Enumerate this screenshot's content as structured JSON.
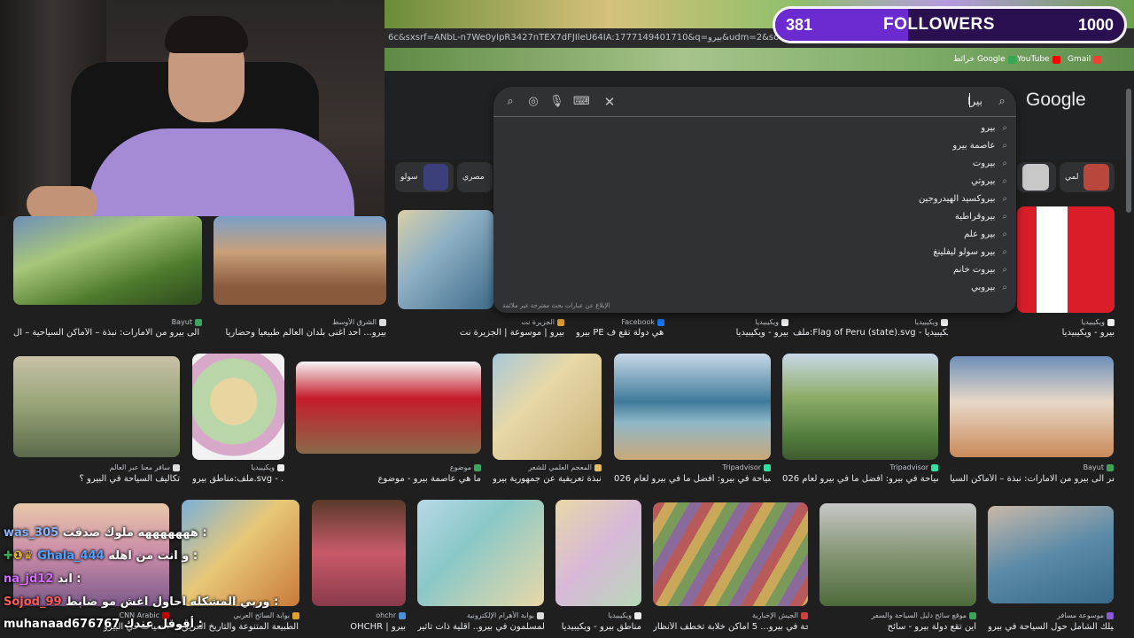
{
  "stream": {
    "followers_count": "381",
    "followers_label": "FOLLOWERS",
    "followers_goal": "1000",
    "followers_progress": 0.381
  },
  "browser": {
    "url_text": "6c&sxsrf=ANbL-n7We0yIpR3427nTEX7dFJIleU64IA:1777149401710&q=بيرو&udm=2&source=iu&ictx=1&",
    "bookmarks": [
      {
        "label": "Gmail",
        "icon": "gmail-icon",
        "color": "#ea4335"
      },
      {
        "label": "YouTube",
        "icon": "youtube-icon",
        "color": "#ff0000"
      },
      {
        "label": "خرائط Google",
        "icon": "maps-icon",
        "color": "#34a853"
      }
    ]
  },
  "google": {
    "logo": "Google",
    "query": "بيرا",
    "suggestions": [
      "بيرو",
      "عاصمة بيرو",
      "بيروت",
      "بيروتي",
      "بيروكسيد الهيدروجين",
      "بيروقراطية",
      "بيرو علم",
      "بيرو سولو ليفلينغ",
      "بيروت خانم",
      "بيروبي"
    ],
    "report_text": "الإبلاغ عن عبارات بحث مقترحة غير ملائمة"
  },
  "chips": [
    {
      "label": "سولو",
      "color": "#3b3f7a"
    },
    {
      "label": "مصري",
      "color": "#303134"
    },
    {
      "label": "",
      "color": "#c8c8c8"
    },
    {
      "label": "لمي",
      "color": "#b9473e"
    }
  ],
  "results_row1": [
    {
      "source": "Bayut",
      "caption": "السفر الى بيرو من الامارات: نبذة – الأماكن السياحية – ال...",
      "colors": [
        "#4d7a2e",
        "#a8c77a",
        "#6e8fb8"
      ]
    },
    {
      "source": "الشرق الأوسط",
      "caption": "بيرو... أحد أغنى بلدان العالم طبيعياً وحضارياً",
      "colors": [
        "#8a5a3c",
        "#c9a07a",
        "#7aa0c8"
      ]
    },
    {
      "source": "الجزيرة نت",
      "caption": "بيرو | موسوعة | الجزيرة نت",
      "colors": [
        "#3e6c8a",
        "#8fb0c4",
        "#d9cfa8"
      ]
    },
    {
      "source": "Facebook",
      "caption": "بيرو PE هي دولة تقع ف...",
      "colors": [
        "#444",
        "#666",
        "#888"
      ]
    },
    {
      "source": "ويكيبيديا",
      "caption": "بيرو - ويكيبيديا",
      "colors": [
        "#d91e2a",
        "#ffffff",
        "#d91e2a"
      ]
    },
    {
      "source": "ويكيبيديا",
      "caption": "ملف:Flag of Peru (state).svg - ويكيبيديا ...",
      "colors": [
        "#d91e2a",
        "#ffffff",
        "#d91e2a"
      ]
    },
    {
      "source": "ويكيبيديا",
      "caption": "بيرو - ويكيبيديا",
      "colors": [
        "#d91e2a",
        "#ffffff",
        "#d91e2a"
      ]
    }
  ],
  "results_row2": [
    {
      "source": "سافر معنا عبر العالم",
      "caption": "تكاليف السياحة في البيرو ؟",
      "colors": [
        "#5c6b4a",
        "#9aa67a",
        "#c9c1a8"
      ]
    },
    {
      "source": "ويكيبيديا",
      "caption": "ملف:مناطق بيرو.svg - ...",
      "colors": [
        "#e8d5a0",
        "#b9d6a8",
        "#d8a8c8"
      ]
    },
    {
      "source": "موضوع",
      "caption": "ما هي عاصمة بيرو - موضوع",
      "colors": [
        "#c61b2a",
        "#f5f5f5",
        "#8a6a4a"
      ]
    },
    {
      "source": "المعجم العلمي للشعر",
      "caption": "نبذة تعريفية عن جمهورية بيرو -",
      "colors": [
        "#c9b178",
        "#e8d8a8",
        "#a8c8d8"
      ]
    },
    {
      "source": "Tripadvisor",
      "caption": "السياحة في بيرو: أفضل ما في بيرو لعام 026",
      "colors": [
        "#3f7a9a",
        "#8fb8c8",
        "#c9a878"
      ]
    },
    {
      "source": "Tripadvisor",
      "caption": "السياحة في بيرو: أفضل ما في بيرو لعام 026",
      "colors": [
        "#4e7a3a",
        "#8fae6a",
        "#3f5a2e"
      ]
    },
    {
      "source": "Bayut",
      "caption": "السفر الى بيرو من الامارات: نبذة – الأماكن السيا...",
      "colors": [
        "#6e8fb8",
        "#c98a5a",
        "#e8d8c8"
      ]
    }
  ],
  "results_row3": [
    {
      "source": "CNN Arabic",
      "caption": "السياحة في البيرو",
      "colors": [
        "#7a5a8a",
        "#c98aa8",
        "#e8c8a8"
      ]
    },
    {
      "source": "بوابة السائح العربي",
      "caption": "الطبيعة المتنوعة والتاريخ العريق ...",
      "colors": [
        "#7ab0d8",
        "#e8c878",
        "#c97a3a"
      ]
    },
    {
      "source": "ohchr",
      "caption": "OHCHR | بيرو",
      "colors": [
        "#8a3a4a",
        "#c95a6a",
        "#5a3a2a"
      ]
    },
    {
      "source": "بوابة الأهرام الإلكترونية",
      "caption": "المسلمون في بيرو.. أقلية ذات تأثير...",
      "colors": [
        "#8ac8c8",
        "#e8d8a8",
        "#b8d8e8"
      ]
    },
    {
      "source": "ويكيبيديا",
      "caption": "مناطق بيرو - ويكيبيديا",
      "colors": [
        "#e8d8a8",
        "#d8b8d8",
        "#b8d8b8"
      ]
    },
    {
      "source": "الجيش الإخبارية",
      "caption": "السياحة في بيرو... 5 أماكن خلابة تخطف الأنظار",
      "colors": [
        "#b85a5a",
        "#7a9a5a",
        "#c9a85a"
      ]
    },
    {
      "source": "موقع سائح دليل السياحة والسفر",
      "caption": "أين تقع دولة بيرو - سائح",
      "colors": [
        "#4e6a3a",
        "#8a9a7a",
        "#c8c8c8"
      ]
    },
    {
      "source": "موسوعة مسافر",
      "caption": "دليلك الشامل حول السياحة في بيرو",
      "colors": [
        "#5a8aa8",
        "#c9b8a8",
        "#3a6a8a"
      ]
    }
  ],
  "chat": [
    {
      "user": "was_305",
      "message": "هههههههه ملوك صدقت :",
      "user_color": "#8ab4f8"
    },
    {
      "user": "Ghala_444",
      "message": "و انت من اهله :",
      "user_color": "#4fa3ff"
    },
    {
      "user": "na_jd12",
      "message": "ابد :",
      "user_color": "#d36bff"
    },
    {
      "user": "Sojod_99",
      "message": "وربي المشكله احاول اغش مو ضابط :",
      "user_color": "#ff5a5a"
    },
    {
      "user": "muhanaad676767",
      "message": "أقوقل عندك :",
      "user_color": "#ffffff"
    }
  ]
}
